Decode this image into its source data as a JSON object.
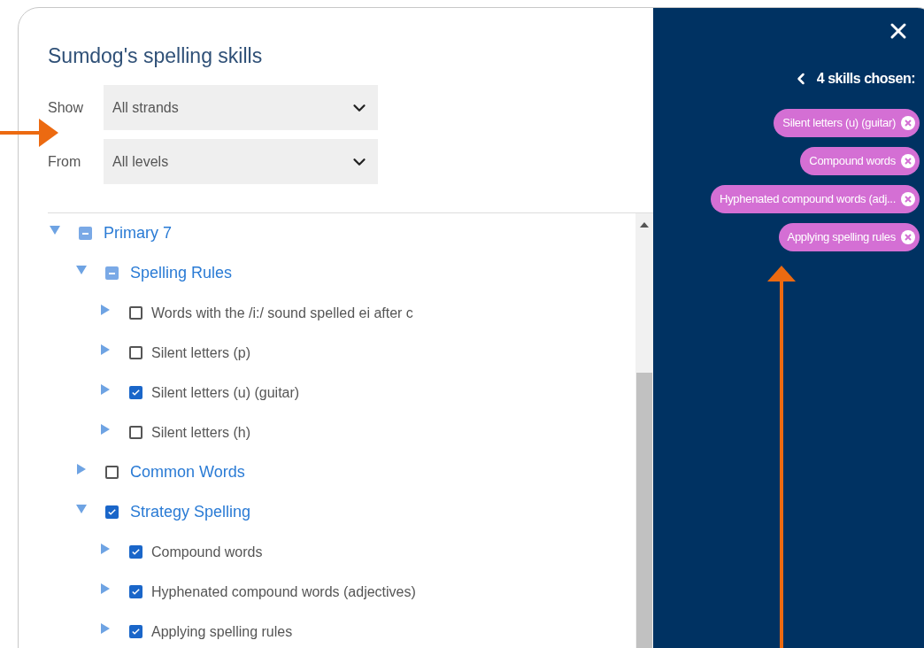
{
  "title": "Sumdog's spelling skills",
  "filters": [
    {
      "label": "Show",
      "value": "All strands"
    },
    {
      "label": "From",
      "value": "All levels"
    }
  ],
  "tree": [
    {
      "label": "Primary 7",
      "expanded": true,
      "partial": true,
      "children": [
        {
          "label": "Spelling Rules",
          "expanded": true,
          "partial": true,
          "children": [
            {
              "label": "Words with the /i:/ sound spelled ei after c",
              "expanded": false,
              "checked": false
            },
            {
              "label": "Silent letters (p)",
              "expanded": false,
              "checked": false
            },
            {
              "label": "Silent letters (u) (guitar)",
              "expanded": false,
              "checked": true
            },
            {
              "label": "Silent letters (h)",
              "expanded": false,
              "checked": false
            }
          ]
        },
        {
          "label": "Common Words",
          "expanded": false,
          "checked": false
        },
        {
          "label": "Strategy Spelling",
          "expanded": true,
          "checked": true,
          "children": [
            {
              "label": "Compound words",
              "expanded": false,
              "checked": true
            },
            {
              "label": "Hyphenated compound words (adjectives)",
              "expanded": false,
              "checked": true
            },
            {
              "label": "Applying spelling rules",
              "expanded": false,
              "checked": true
            }
          ]
        }
      ]
    }
  ],
  "chosen": {
    "heading": "4 skills chosen:",
    "chips": [
      "Silent letters (u) (guitar)",
      "Compound words",
      "Hyphenated compound words (adj...",
      "Applying spelling rules"
    ]
  }
}
